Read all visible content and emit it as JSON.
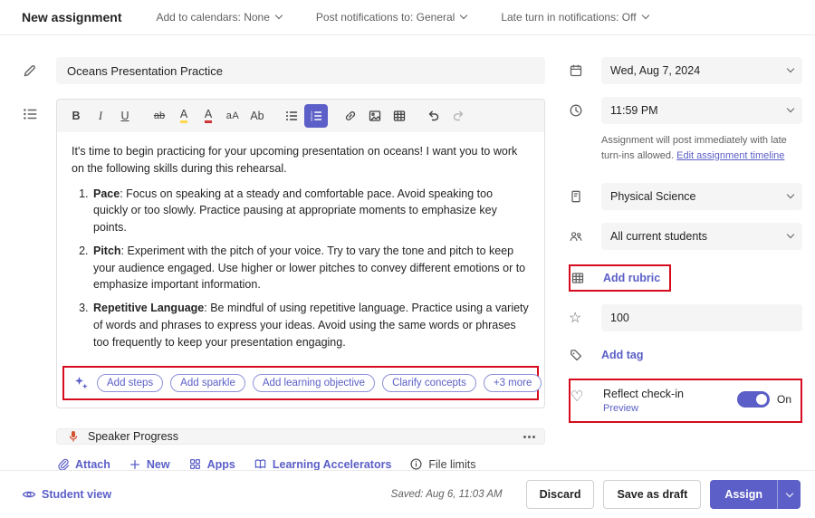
{
  "colors": {
    "accent": "#5b5fc7",
    "annotation": "#d60b1e",
    "field_bg": "#f5f5f5"
  },
  "header": {
    "title": "New assignment",
    "menus": [
      {
        "label": "Add to calendars: None"
      },
      {
        "label": "Post notifications to: General"
      },
      {
        "label": "Late turn in notifications: Off"
      }
    ]
  },
  "toolbar": {
    "bold": "B",
    "italic": "I",
    "underline": "U",
    "strikethrough": "ab",
    "highlight": "A",
    "font_color": "A",
    "font_size": "aA",
    "clear_format": "Ab"
  },
  "main": {
    "title_value": "Oceans Presentation Practice",
    "editor": {
      "intro": "It's time to begin practicing for your upcoming presentation on oceans! I want you to work on the following skills during this rehearsal.",
      "list": [
        {
          "term": "Pace",
          "text": ": Focus on speaking at a steady and comfortable pace. Avoid speaking too quickly or too slowly. Practice pausing at appropriate moments to emphasize key points."
        },
        {
          "term": "Pitch",
          "text": ": Experiment with the pitch of your voice. Try to vary the tone and pitch to keep your audience engaged. Use higher or lower pitches to convey different emotions or to emphasize important information."
        },
        {
          "term": "Repetitive Language",
          "text": ": Be mindful of using repetitive language. Practice using a variety of words and phrases to express your ideas. Avoid using the same words or phrases too frequently to keep your presentation engaging."
        }
      ]
    },
    "ai_pills": [
      "Add steps",
      "Add sparkle",
      "Add learning objective",
      "Clarify concepts",
      "+3 more"
    ],
    "attachment": {
      "name": "Speaker Progress"
    },
    "actions": {
      "attach": "Attach",
      "new": "New",
      "apps": "Apps",
      "accelerators": "Learning Accelerators",
      "file_limits": "File limits"
    }
  },
  "sidebar": {
    "date": "Wed, Aug 7, 2024",
    "time": "11:59 PM",
    "timeline_note": "Assignment will post immediately with late turn-ins allowed.",
    "timeline_link": "Edit assignment timeline",
    "subject": "Physical Science",
    "students": "All current students",
    "add_rubric": "Add rubric",
    "points": "100",
    "add_tag": "Add tag",
    "reflect": {
      "label": "Reflect check-in",
      "preview": "Preview",
      "state": "On"
    }
  },
  "footer": {
    "student_view": "Student view",
    "saved": "Saved: Aug 6, 11:03 AM",
    "discard": "Discard",
    "save_draft": "Save as draft",
    "assign": "Assign"
  }
}
